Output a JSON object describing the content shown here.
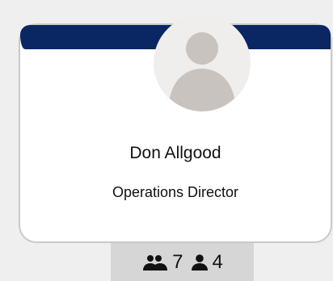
{
  "profile": {
    "name": "Don Allgood",
    "title": "Operations Director"
  },
  "stats": {
    "group_count": "7",
    "person_count": "4",
    "group_icon": "people-icon",
    "person_icon": "person-icon"
  },
  "colors": {
    "header": "#0a2663",
    "card_border": "#c9c9c9",
    "stats_background": "#d6d6d6",
    "avatar_background": "#efeeec",
    "avatar_figure": "#c8c3bf"
  }
}
